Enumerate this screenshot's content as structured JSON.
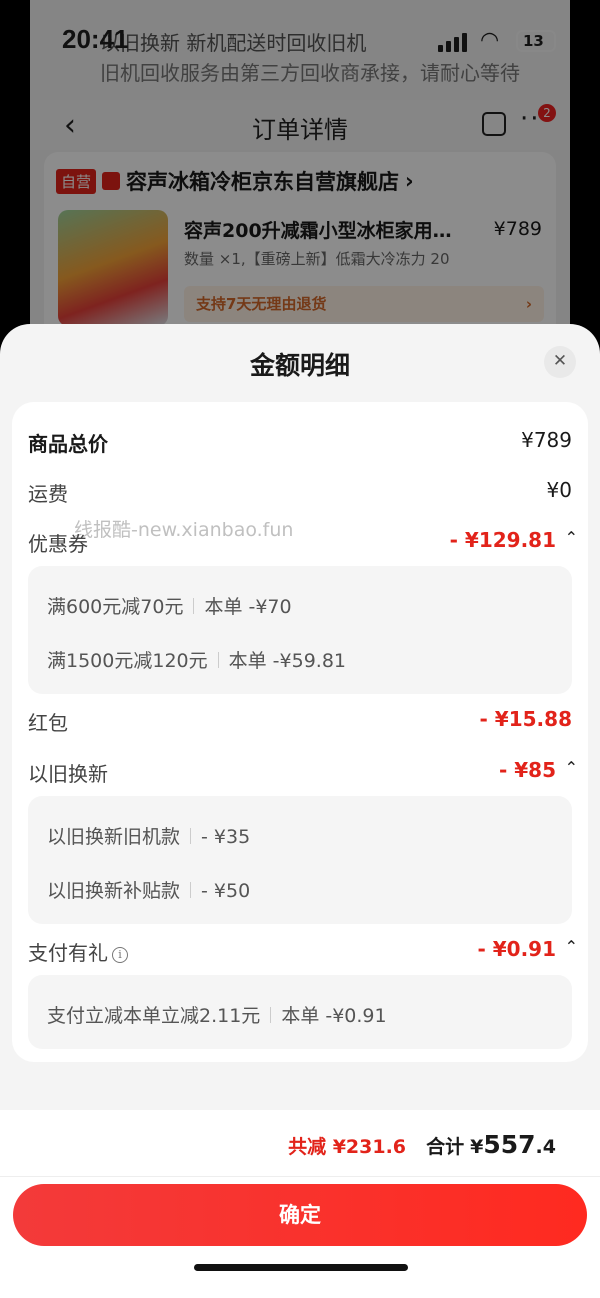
{
  "status_bar": {
    "time": "20:41",
    "battery": "13"
  },
  "background_page": {
    "banner_line1": "以旧换新 新机配送时回收旧机",
    "banner_line2": "旧机回收服务由第三方回收商承接，请耐心等待",
    "title": "订单详情",
    "badge_count": "2",
    "shop_tag": "自营",
    "shop_name": "容声冰箱冷柜京东自营旗舰店",
    "product_name": "容声200升减霜小型冰柜家用…",
    "product_price": "¥789",
    "product_spec": "数量 ×1,【重磅上新】低霜大冷冻力 20",
    "return_policy": "支持7天无理由退货"
  },
  "sheet": {
    "title": "金额明细",
    "watermark": "线报酷-new.xianbao.fun",
    "rows": {
      "goods_total": {
        "label": "商品总价",
        "value": "¥789"
      },
      "shipping": {
        "label": "运费",
        "value": "¥0"
      },
      "coupon": {
        "label": "优惠券",
        "value": "- ¥129.81"
      },
      "red_packet": {
        "label": "红包",
        "value": "- ¥15.88"
      },
      "trade_in": {
        "label": "以旧换新",
        "value": "- ¥85"
      },
      "pay_gift": {
        "label": "支付有礼",
        "value": "- ¥0.91"
      }
    },
    "coupon_items": [
      {
        "name": "满600元减70元",
        "amount": "本单 -¥70"
      },
      {
        "name": "满1500元减120元",
        "amount": "本单 -¥59.81"
      }
    ],
    "trade_in_items": [
      {
        "name": "以旧换新旧机款",
        "amount": "- ¥35"
      },
      {
        "name": "以旧换新补贴款",
        "amount": "- ¥50"
      }
    ],
    "pay_gift_items": [
      {
        "name": "支付立减本单立减2.11元",
        "amount": "本单 -¥0.91"
      }
    ]
  },
  "footer": {
    "saved": "共减 ¥231.6",
    "total_label": "合计",
    "total_symbol": "¥",
    "total_int": "557",
    "total_dec": ".4",
    "confirm_label": "确定"
  },
  "colors": {
    "accent": "#e2231a",
    "button": "#f33a3a"
  }
}
